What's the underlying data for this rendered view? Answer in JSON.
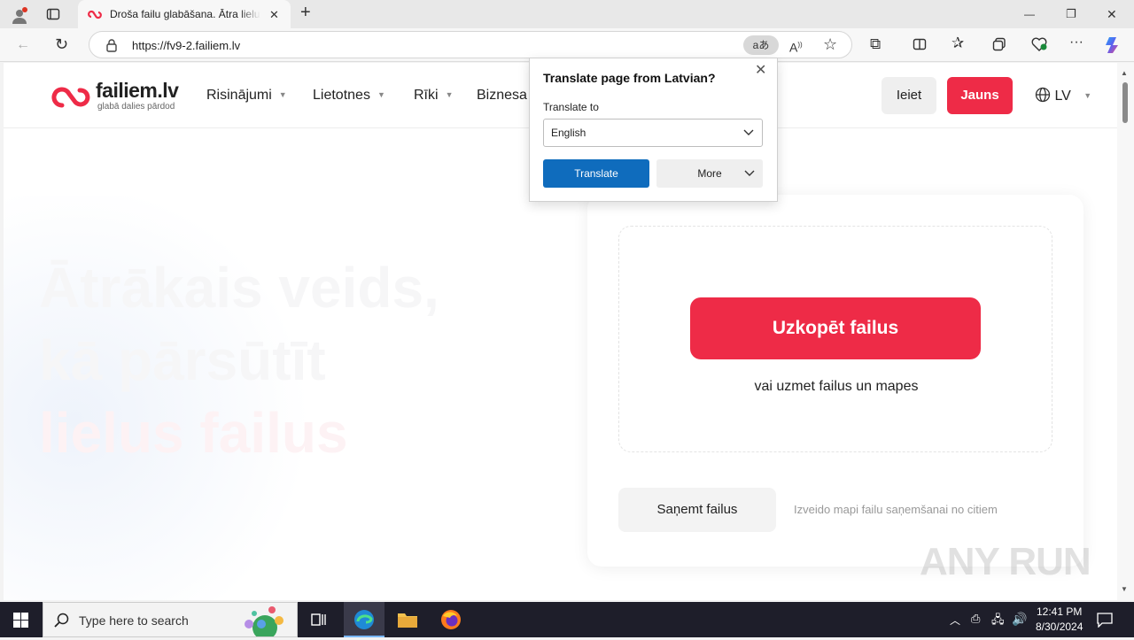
{
  "browser": {
    "tab_title": "Droša failu glabāšana. Ātra lielu f",
    "url": "https://fv9-2.failiem.lv",
    "translate_icon": "aあ",
    "win_min": "—",
    "win_restore": "❐",
    "win_close": "✕"
  },
  "site": {
    "logo_text": "failiem.lv",
    "logo_tagline": "glabā dalies pārdod",
    "nav": [
      "Risinājumi",
      "Lietotnes",
      "Rīki",
      "Biznesa"
    ],
    "login": "Ieiet",
    "signup": "Jauns",
    "lang": "LV",
    "accent": "#ee2b47"
  },
  "hero": {
    "line1": "Ātrākais veids,",
    "line2": "kā pārsūtīt",
    "line3a": "lielus",
    "line3b": "failus"
  },
  "upload": {
    "button": "Uzkopēt failus",
    "drag_text": "vai uzmet failus un mapes",
    "receive_button": "Saņemt failus",
    "receive_desc": "Izveido mapi failu saņemšanai no citiem"
  },
  "translate_popup": {
    "title": "Translate page from Latvian?",
    "label": "Translate to",
    "selected": "English",
    "translate_button": "Translate",
    "more_button": "More",
    "accent": "#0f6cbd"
  },
  "taskbar": {
    "search_placeholder": "Type here to search",
    "time": "12:41 PM",
    "date": "8/30/2024"
  },
  "watermark": "ANY RUN"
}
